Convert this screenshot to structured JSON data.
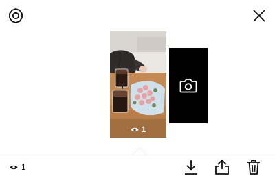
{
  "story": {
    "view_count": "1"
  },
  "footer": {
    "view_count": "1"
  },
  "icons": {
    "settings": "settings-icon",
    "close": "close-icon",
    "camera": "camera-icon",
    "eye": "eye-icon",
    "download": "download-icon",
    "share": "share-icon",
    "delete": "trash-icon"
  },
  "colors": {
    "background": "#ffffff",
    "icon": "#111111",
    "camera_card": "#000000",
    "divider": "#e6e6e6"
  }
}
